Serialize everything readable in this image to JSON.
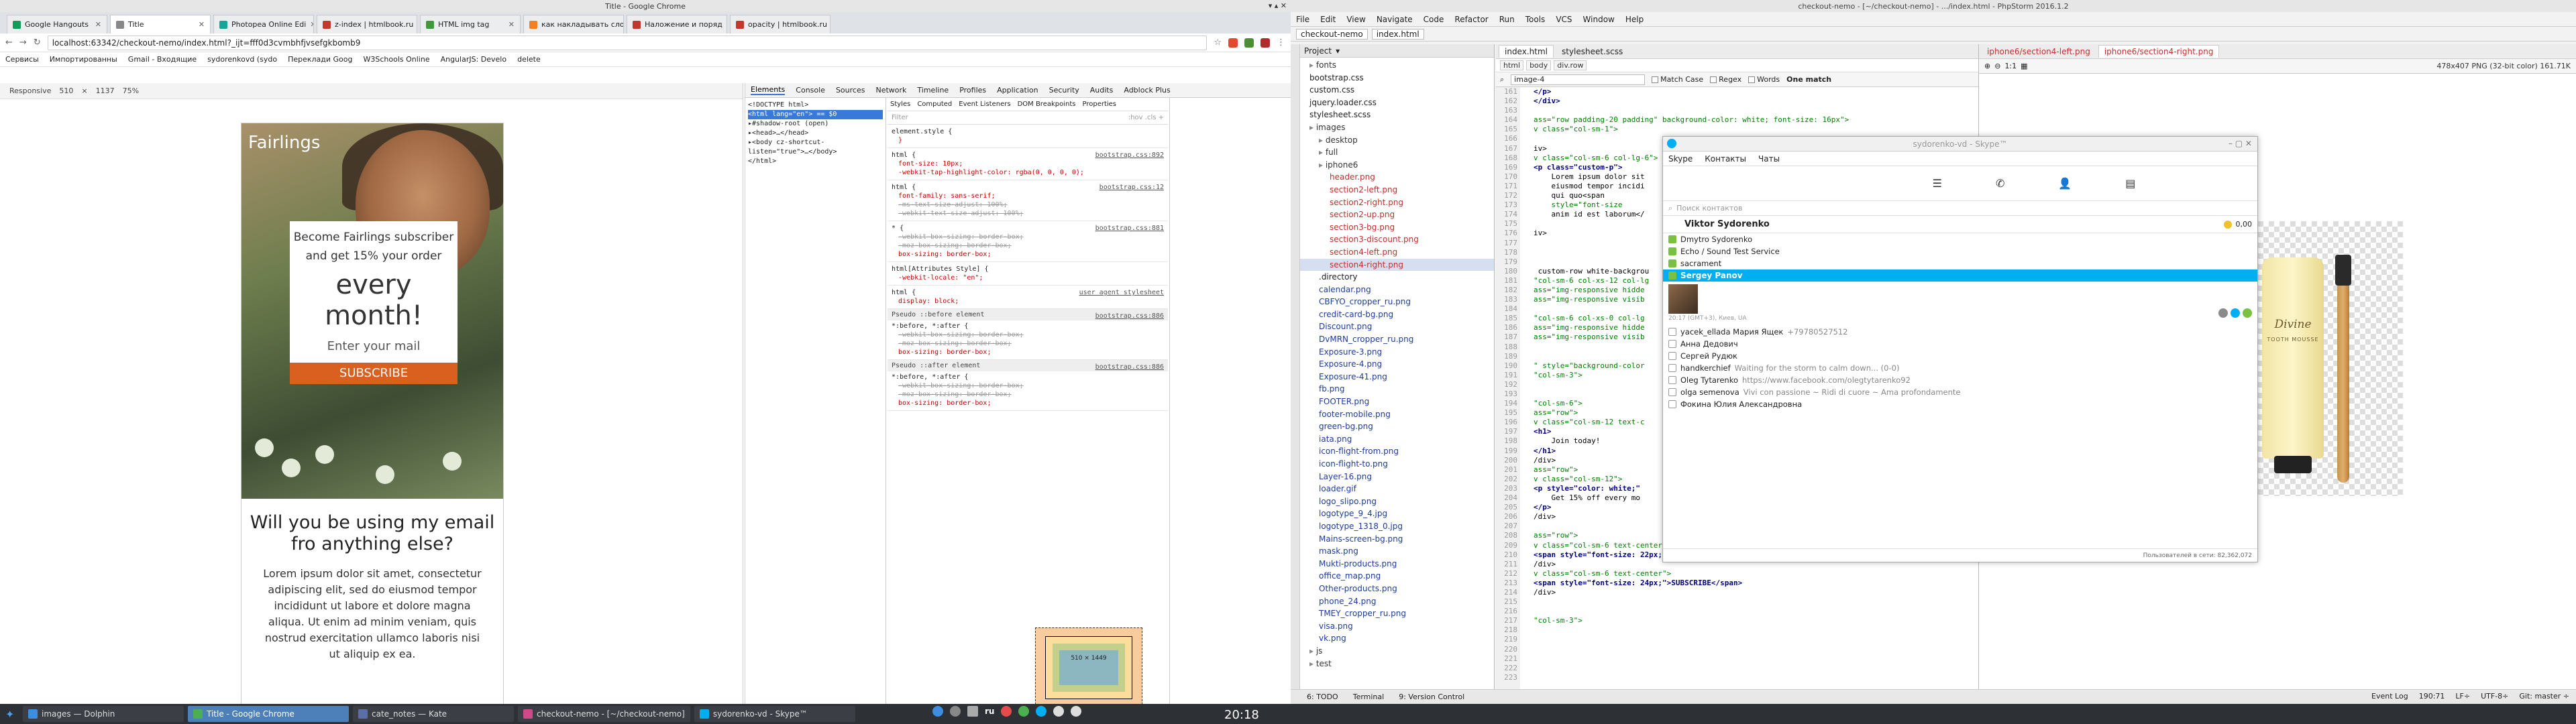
{
  "chrome": {
    "title": "Title - Google Chrome",
    "tabs": [
      {
        "label": "Google Hangouts",
        "color": "#0f9d58"
      },
      {
        "label": "Title",
        "color": "#888888"
      },
      {
        "label": "Photopea Online Edi",
        "color": "#18a497"
      },
      {
        "label": "z-index | htmlbook.ru",
        "color": "#c0392b"
      },
      {
        "label": "HTML img tag",
        "color": "#3c9a3c"
      },
      {
        "label": "как накладывать слои",
        "color": "#f48024"
      },
      {
        "label": "Наложение и поряд",
        "color": "#c0392b"
      },
      {
        "label": "opacity | htmlbook.ru",
        "color": "#c0392b"
      }
    ],
    "url": "localhost:63342/checkout-nemo/index.html?_ijt=fff0d3cvmbhfjvsefgkbomb9",
    "bookmarks": [
      "Сервисы",
      "Импортированны",
      "Gmail - Входящие",
      "sydorenkovd (sydo",
      "Переклади Goog",
      "W3Schools Online",
      "AngularJS: Develo",
      "delete"
    ],
    "device_bar": {
      "mode": "Responsive",
      "width": "510",
      "height": "1137",
      "zoom": "75%"
    }
  },
  "page": {
    "brand": "Fairlings",
    "promo_line1": "Become Fairlings subscriber",
    "promo_line2": "and get 15% your order",
    "promo_big": "every month!",
    "promo_email": "Enter your mail",
    "promo_button": "SUBSCRIBE",
    "question": "Will you be using my email fro anything else?",
    "lorem": "Lorem ipsum dolor sit amet, consectetur adipiscing elit, sed do eiusmod tempor incididunt ut labore et dolore magna aliqua. Ut enim ad minim veniam, quis nostrud exercitation ullamco laboris nisi ut aliquip ex ea."
  },
  "devtools": {
    "tabs": [
      "Elements",
      "Console",
      "Sources",
      "Network",
      "Timeline",
      "Profiles",
      "Application",
      "Security",
      "Audits",
      "Adblock Plus"
    ],
    "dom": [
      "<!DOCTYPE html>",
      "<html lang=\"en\"> == $0",
      "▸#shadow-root (open)",
      "▸<head>…</head>",
      "▸<body cz-shortcut-listen=\"true\">…</body>",
      "</html>"
    ],
    "style_tabs": [
      "Styles",
      "Computed",
      "Event Listeners",
      "DOM Breakpoints",
      "Properties"
    ],
    "filter": "Filter",
    "filter_opts": ":hov  .cls  +",
    "rules": [
      {
        "selector": "element.style {",
        "props": [
          "}"
        ],
        "src": ""
      },
      {
        "selector": "html {",
        "props": [
          "font-size: 10px;",
          "-webkit-tap-highlight-color: rgba(0, 0, 0, 0);"
        ],
        "src": "bootstrap.css:892"
      },
      {
        "selector": "html {",
        "props": [
          "font-family: sans-serif;",
          "-ms-text-size-adjust: 100%;",
          "-webkit-text-size-adjust: 100%;"
        ],
        "src": "bootstrap.css:12"
      },
      {
        "selector": "* {",
        "props": [
          "-webkit-box-sizing: border-box;",
          "-moz-box-sizing: border-box;",
          "box-sizing: border-box;"
        ],
        "src": "bootstrap.css:881"
      },
      {
        "selector": "html[Attributes Style] {",
        "props": [
          "-webkit-locale: \"en\";"
        ],
        "src": ""
      },
      {
        "selector": "html {",
        "props": [
          "display: block;"
        ],
        "src": "user agent stylesheet"
      }
    ],
    "pseudo_before": {
      "title": "Pseudo ::before element",
      "selector": "*:before, *:after {",
      "props": [
        "-webkit-box-sizing: border-box;",
        "-moz-box-sizing: border-box;",
        "box-sizing: border-box;"
      ],
      "src": "bootstrap.css:886"
    },
    "pseudo_after": {
      "title": "Pseudo ::after element",
      "selector": "*:before, *:after {",
      "props": [
        "-webkit-box-sizing: border-box;",
        "-moz-box-sizing: border-box;",
        "box-sizing: border-box;"
      ],
      "src": "bootstrap.css:886"
    },
    "boxmodel": {
      "margin": "margin",
      "border": "border",
      "padding": "padding",
      "content": "510 × 1449"
    },
    "breadcrumb": "html"
  },
  "phpstorm": {
    "title": "checkout-nemo - [~/checkout-nemo] - .../index.html - PhpStorm 2016.1.2",
    "menu": [
      "File",
      "Edit",
      "View",
      "Navigate",
      "Code",
      "Refactor",
      "Run",
      "Tools",
      "VCS",
      "Window",
      "Help"
    ],
    "nav_crumbs": [
      "checkout-nemo",
      "index.html"
    ],
    "project_label": "Project",
    "tree": [
      {
        "name": "fonts",
        "kind": "folder"
      },
      {
        "name": "bootstrap.css",
        "kind": "file"
      },
      {
        "name": "custom.css",
        "kind": "file"
      },
      {
        "name": "jquery.loader.css",
        "kind": "file"
      },
      {
        "name": "stylesheet.scss",
        "kind": "file"
      },
      {
        "name": "images",
        "kind": "folder"
      },
      {
        "name": "desktop",
        "kind": "folder"
      },
      {
        "name": "full",
        "kind": "folder"
      },
      {
        "name": "iphone6",
        "kind": "folder"
      },
      {
        "name": "header.png",
        "kind": "red"
      },
      {
        "name": "section2-left.png",
        "kind": "red"
      },
      {
        "name": "section2-right.png",
        "kind": "red"
      },
      {
        "name": "section2-up.png",
        "kind": "red"
      },
      {
        "name": "section3-bg.png",
        "kind": "red"
      },
      {
        "name": "section3-discount.png",
        "kind": "red"
      },
      {
        "name": "section4-left.png",
        "kind": "red"
      },
      {
        "name": "section4-right.png",
        "kind": "red"
      },
      {
        "name": ".directory",
        "kind": "file"
      },
      {
        "name": "calendar.png",
        "kind": "img"
      },
      {
        "name": "CBFYO_cropper_ru.png",
        "kind": "img"
      },
      {
        "name": "credit-card-bg.png",
        "kind": "img"
      },
      {
        "name": "Discount.png",
        "kind": "img"
      },
      {
        "name": "DvMRN_cropper_ru.png",
        "kind": "img"
      },
      {
        "name": "Exposure-3.png",
        "kind": "img"
      },
      {
        "name": "Exposure-4.png",
        "kind": "img"
      },
      {
        "name": "Exposure-41.png",
        "kind": "img"
      },
      {
        "name": "fb.png",
        "kind": "img"
      },
      {
        "name": "FOOTER.png",
        "kind": "img"
      },
      {
        "name": "footer-mobile.png",
        "kind": "img"
      },
      {
        "name": "green-bg.png",
        "kind": "img"
      },
      {
        "name": "iata.png",
        "kind": "img"
      },
      {
        "name": "icon-flight-from.png",
        "kind": "img"
      },
      {
        "name": "icon-flight-to.png",
        "kind": "img"
      },
      {
        "name": "Layer-16.png",
        "kind": "img"
      },
      {
        "name": "loader.gif",
        "kind": "img"
      },
      {
        "name": "logo_slipo.png",
        "kind": "img"
      },
      {
        "name": "logotype_9_4.jpg",
        "kind": "img"
      },
      {
        "name": "logotype_1318_0.jpg",
        "kind": "img"
      },
      {
        "name": "Mains-screen-bg.png",
        "kind": "img"
      },
      {
        "name": "mask.png",
        "kind": "img"
      },
      {
        "name": "Mukti-products.png",
        "kind": "img"
      },
      {
        "name": "office_map.png",
        "kind": "img"
      },
      {
        "name": "Other-products.png",
        "kind": "img"
      },
      {
        "name": "phone_24.png",
        "kind": "img"
      },
      {
        "name": "TMEY_cropper_ru.png",
        "kind": "img"
      },
      {
        "name": "visa.png",
        "kind": "img"
      },
      {
        "name": "vk.png",
        "kind": "img"
      },
      {
        "name": "js",
        "kind": "folder"
      },
      {
        "name": "test",
        "kind": "folder"
      }
    ],
    "editor_tabs": [
      "index.html",
      "stylesheet.scss"
    ],
    "editor_crumbs": [
      "html",
      "body",
      "div.row"
    ],
    "find_value": "image-4",
    "find_opts": [
      "Match Case",
      "Regex",
      "Words"
    ],
    "find_result": "One match",
    "line_numbers": [
      "161",
      "162",
      "163",
      "164",
      "165",
      "166",
      "167",
      "168",
      "169",
      "170",
      "171",
      "172",
      "173",
      "174",
      "175",
      "176",
      "177",
      "178",
      "179",
      "180",
      "181",
      "182",
      "183",
      "184",
      "185",
      "186",
      "187",
      "188",
      "189",
      "190",
      "191",
      "192",
      "193",
      "194",
      "195",
      "196",
      "197",
      "198",
      "199",
      "200",
      "201",
      "202",
      "203",
      "204",
      "205",
      "206",
      "207",
      "208",
      "209",
      "210",
      "211",
      "212",
      "213",
      "214",
      "215",
      "216",
      "217",
      "218",
      "219",
      "220",
      "221",
      "222",
      "223"
    ],
    "code": [
      "</p>",
      "</div>",
      "",
      "ass=\"row padding-20 padding\" background-color: white; font-size: 16px\">",
      "v class=\"col-sm-1\">",
      "",
      "iv>",
      "v class=\"col-sm-6 col-lg-6\">",
      "<p class=\"custom-p\">",
      "    Lorem ipsum dolor sit",
      "    eiusmod tempor incidi",
      "    qui quo<span",
      "    style=\"font-size",
      "    anim id est laborum</",
      "",
      "iv>",
      "",
      "",
      "",
      " custom-row white-backgrou",
      "\"col-sm-6 col-xs-12 col-lg",
      "ass=\"img-responsive hidde",
      "ass=\"img-responsive visib",
      "",
      "\"col-sm-6 col-xs-0 col-lg",
      "ass=\"img-responsive hidde",
      "ass=\"img-responsive visib",
      "",
      "",
      "\" style=\"background-color",
      "\"col-sm-3\">",
      "",
      "",
      "\"col-sm-6\">",
      "ass=\"row\">",
      "v class=\"col-sm-12 text-c",
      "<h1>",
      "    Join today!",
      "</h1>",
      "/div>",
      "ass=\"row\">",
      "v class=\"col-sm-12\">",
      "<p style=\"color: white;\"",
      "    Get 15% off every mo",
      "</p>",
      "/div>",
      "",
      "ass=\"row\">",
      "v class=\"col-sm-6 text-center\">",
      "<span style=\"font-size: 22px; color: #e5dcee;\">ENTER YOUR MAIL</span>",
      "/div>",
      "v class=\"col-sm-6 text-center\">",
      "<span style=\"font-size: 24px;\">SUBSCRIBE</span>",
      "/div>",
      "",
      "",
      "\"col-sm-3\">",
      "",
      "",
      "",
      "",
      "",
      "",
      ""
    ],
    "image_tabs": [
      "iphone6/section4-left.png",
      "iphone6/section4-right.png"
    ],
    "image_info": "478x407 PNG (32-bit color) 161.71K",
    "product_brand": "Divine",
    "product_sub": "TOOTH MOUSSE",
    "toolwindows": [
      "6: TODO",
      "Terminal",
      "9: Version Control"
    ],
    "event_log": "Event Log",
    "status": {
      "pos": "190:71",
      "lf": "LF÷",
      "enc": "UTF-8÷",
      "git": "Git: master ÷"
    }
  },
  "skype": {
    "title": "sydorenko-vd - Skype™",
    "menu": [
      "Skype",
      "Контакты",
      "Чаты"
    ],
    "search_placeholder": "Поиск контактов",
    "account": "Viktor Sydorenko",
    "balance": "0,00",
    "contacts": [
      {
        "name": "Dmytro Sydorenko",
        "mood": "",
        "status": "online"
      },
      {
        "name": "Echo / Sound Test Service",
        "mood": "",
        "status": "online"
      },
      {
        "name": "sacrament",
        "mood": "",
        "status": "online"
      }
    ],
    "selected_contact": "Sergey Panov",
    "selected_location": "20:17 (GMT+3), Киев, UA",
    "contacts_more": [
      {
        "name": "yacek_ellada Мария Ящек",
        "mood": "+79780527512",
        "status": "offline"
      },
      {
        "name": "Анна Дедович",
        "mood": "",
        "status": "offline"
      },
      {
        "name": "Сергей Рудюк",
        "mood": "",
        "status": "offline"
      },
      {
        "name": "handkerchief",
        "mood": "Waiting for the storm to calm down... (0-0)",
        "status": "offline"
      },
      {
        "name": "Oleg Tytarenko",
        "mood": "https://www.facebook.com/olegtytarenko92",
        "status": "offline"
      },
      {
        "name": "olga semenova",
        "mood": "Vivi con passione ~ Ridi di cuore ~ Ama profondamente",
        "status": "offline"
      },
      {
        "name": "Фокина Юлия Александровна",
        "mood": "",
        "status": "offline"
      }
    ],
    "footer": "Пользователей в сети: 82,362,072"
  },
  "taskbar": {
    "tasks": [
      {
        "label": "images — Dolphin",
        "color": "#3a8ee6"
      },
      {
        "label": "Title - Google Chrome",
        "color": "#4caf50"
      },
      {
        "label": "cate_notes — Kate",
        "color": "#5a6fa8"
      },
      {
        "label": "checkout-nemo - [~/checkout-nemo]",
        "color": "#d04a8a"
      },
      {
        "label": "sydorenko-vd - Skype™",
        "color": "#00aff0"
      }
    ],
    "lang": "ru",
    "clock": "20:18"
  }
}
